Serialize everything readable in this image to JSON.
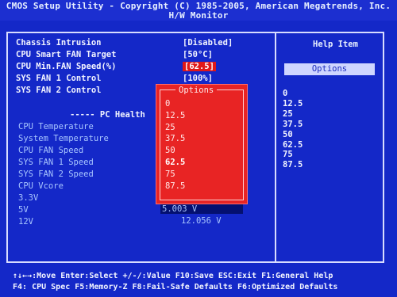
{
  "header": {
    "title": "CMOS Setup Utility - Copyright (C) 1985-2005, American Megatrends, Inc.",
    "subtitle": "H/W Monitor"
  },
  "settings": [
    {
      "label": "Chassis Intrusion",
      "value": "[Disabled]"
    },
    {
      "label": "CPU Smart FAN Target",
      "value": "[50°C]"
    },
    {
      "label": "CPU Min.FAN Speed(%)",
      "value": "[62.5]"
    },
    {
      "label": "SYS FAN 1 Control",
      "value": "[100%]"
    },
    {
      "label": "SYS FAN 2 Control",
      "value": ""
    }
  ],
  "pc_health": {
    "heading": "----- PC Health",
    "items": [
      {
        "label": "CPU Temperature",
        "value": ""
      },
      {
        "label": "System Temperature",
        "value": ""
      },
      {
        "label": "CPU FAN Speed",
        "value": ""
      },
      {
        "label": "SYS FAN 1 Speed",
        "value": ""
      },
      {
        "label": "SYS FAN 2 Speed",
        "value": ""
      },
      {
        "label": "CPU Vcore",
        "value": ""
      },
      {
        "label": "3.3V",
        "value": ""
      },
      {
        "label": "5V",
        "value": "5.003 V"
      },
      {
        "label": "12V",
        "value": "12.056 V"
      }
    ]
  },
  "popup": {
    "title": "Options",
    "items": [
      "0",
      "12.5",
      "25",
      "37.5",
      "50",
      "62.5",
      "75",
      "87.5"
    ],
    "selected_index": 5
  },
  "help": {
    "title": "Help Item",
    "options_label": "Options",
    "items": [
      "0",
      "12.5",
      "25",
      "37.5",
      "50",
      "62.5",
      "75",
      "87.5"
    ]
  },
  "footer": {
    "line1": "↑↓←→:Move  Enter:Select  +/-/:Value  F10:Save  ESC:Exit  F1:General Help",
    "line2": "F4: CPU Spec  F5:Memory-Z  F8:Fail-Safe Defaults  F6:Optimized Defaults"
  },
  "colors": {
    "background": "#1428c8",
    "popup": "#e82424",
    "highlight": "#e01818"
  }
}
